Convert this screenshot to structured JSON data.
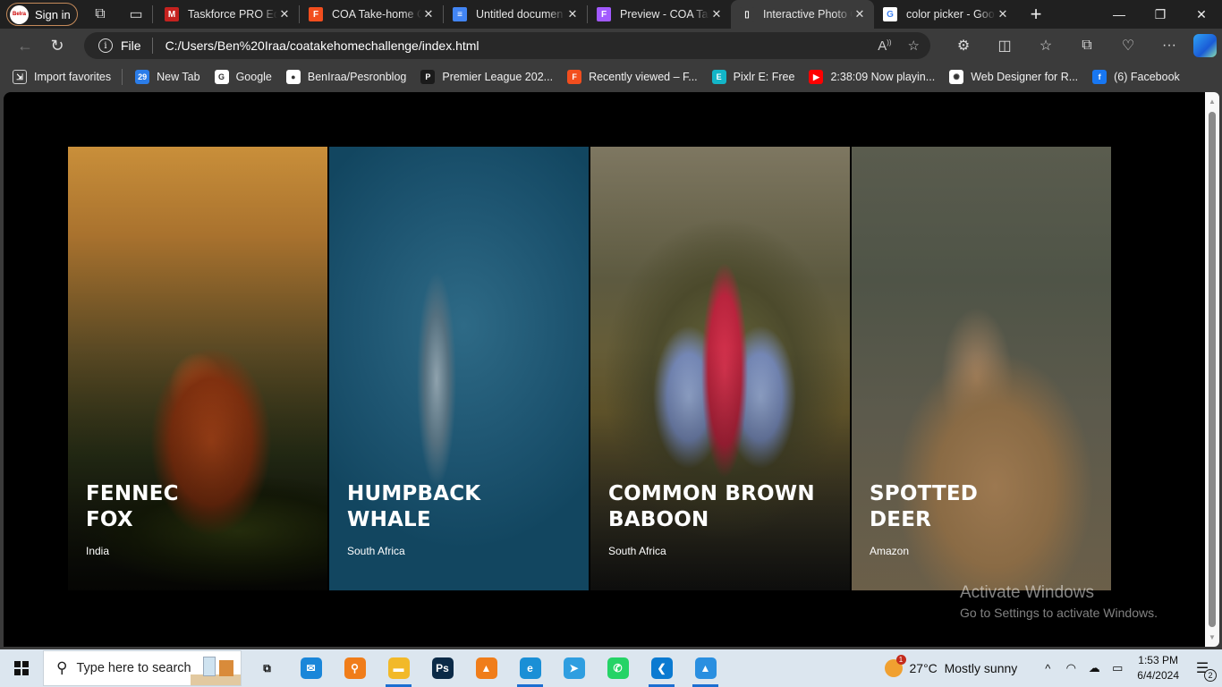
{
  "browser": {
    "profile_label": "Sign in",
    "tabs": [
      {
        "title": "Taskforce PRO Edit",
        "icon": "gmail-icon",
        "color": "#c5221f",
        "glyph": "M",
        "active": false
      },
      {
        "title": "COA Take-home C",
        "icon": "figma-icon",
        "color": "#f24e1e",
        "glyph": "F",
        "active": false
      },
      {
        "title": "Untitled documen",
        "icon": "google-docs-icon",
        "color": "#4285f4",
        "glyph": "≡",
        "active": false
      },
      {
        "title": "Preview - COA Tak",
        "icon": "figma-icon",
        "color": "#a259ff",
        "glyph": "F",
        "active": false
      },
      {
        "title": "Interactive Photo G",
        "icon": "file-icon",
        "color": "#3b3b3b",
        "glyph": "▯",
        "active": true
      },
      {
        "title": "color picker - Goo",
        "icon": "google-icon",
        "color": "#ffffff",
        "glyph": "G",
        "active": false
      }
    ],
    "address": {
      "scheme_label": "File",
      "url": "C:/Users/Ben%20Iraa/coatakehomechallenge/index.html"
    },
    "favorites": [
      {
        "label": "Import favorites",
        "icon": "import-icon",
        "color": "transparent",
        "glyph": "⇲"
      },
      {
        "label": "New Tab",
        "icon": "calendar-icon",
        "color": "#2b7de9",
        "glyph": "29"
      },
      {
        "label": "Google",
        "icon": "google-icon",
        "color": "#ffffff",
        "glyph": "G"
      },
      {
        "label": "BenIraa/Pesronblog",
        "icon": "github-icon",
        "color": "#ffffff",
        "glyph": "●"
      },
      {
        "label": "Premier League 202...",
        "icon": "premier-league-icon",
        "color": "#1b1b1b",
        "glyph": "P"
      },
      {
        "label": "Recently viewed – F...",
        "icon": "figma-icon",
        "color": "#f24e1e",
        "glyph": "F"
      },
      {
        "label": "Pixlr E: Free",
        "icon": "pixlr-icon",
        "color": "#13b5c7",
        "glyph": "E"
      },
      {
        "label": "2:38:09 Now playin...",
        "icon": "youtube-icon",
        "color": "#ff0000",
        "glyph": "▶"
      },
      {
        "label": "Web Designer for R...",
        "icon": "chatgpt-icon",
        "color": "#ffffff",
        "glyph": "✺"
      },
      {
        "label": "(6) Facebook",
        "icon": "facebook-icon",
        "color": "#1877f2",
        "glyph": "f"
      }
    ]
  },
  "page": {
    "cards": [
      {
        "name": "Fennec Fox",
        "name_line1": "FENNEC",
        "name_line2": "FOX",
        "location": "India"
      },
      {
        "name": "Humpback Whale",
        "name_line1": "HUMPBACK",
        "name_line2": "WHALE",
        "location": "South Africa"
      },
      {
        "name": "Common Brown Baboon",
        "name_line1": "COMMON BROWN",
        "name_line2": "BABOON",
        "location": "South Africa"
      },
      {
        "name": "Spotted Deer",
        "name_line1": "SPOTTED",
        "name_line2": "DEER",
        "location": "Amazon"
      }
    ],
    "watermark": {
      "title": "Activate Windows",
      "subtitle": "Go to Settings to activate Windows."
    }
  },
  "taskbar": {
    "search_placeholder": "Type here to search",
    "apps": [
      {
        "name": "task-view",
        "glyph": "⧉",
        "color": "transparent",
        "running": false
      },
      {
        "name": "mail",
        "glyph": "✉",
        "color": "#1a86d9",
        "running": false
      },
      {
        "name": "search-app",
        "glyph": "⚲",
        "color": "#f07d1a",
        "running": false
      },
      {
        "name": "file-explorer",
        "glyph": "▬",
        "color": "#f2b929",
        "running": true
      },
      {
        "name": "photoshop",
        "glyph": "Ps",
        "color": "#0b2a47",
        "running": false
      },
      {
        "name": "vlc",
        "glyph": "▲",
        "color": "#f07d1a",
        "running": false
      },
      {
        "name": "edge",
        "glyph": "e",
        "color": "#1a8fd6",
        "running": true
      },
      {
        "name": "telegram",
        "glyph": "➤",
        "color": "#2f9ee0",
        "running": false
      },
      {
        "name": "whatsapp",
        "glyph": "✆",
        "color": "#25d366",
        "running": false
      },
      {
        "name": "vscode",
        "glyph": "❮",
        "color": "#0b7ad1",
        "running": true
      },
      {
        "name": "photos",
        "glyph": "▲",
        "color": "#2a8fe0",
        "running": true
      }
    ],
    "weather": {
      "temp": "27°C",
      "condition": "Mostly sunny",
      "badge": "1"
    },
    "clock": {
      "time": "1:53 PM",
      "date": "6/4/2024"
    },
    "notifications_count": "2"
  }
}
